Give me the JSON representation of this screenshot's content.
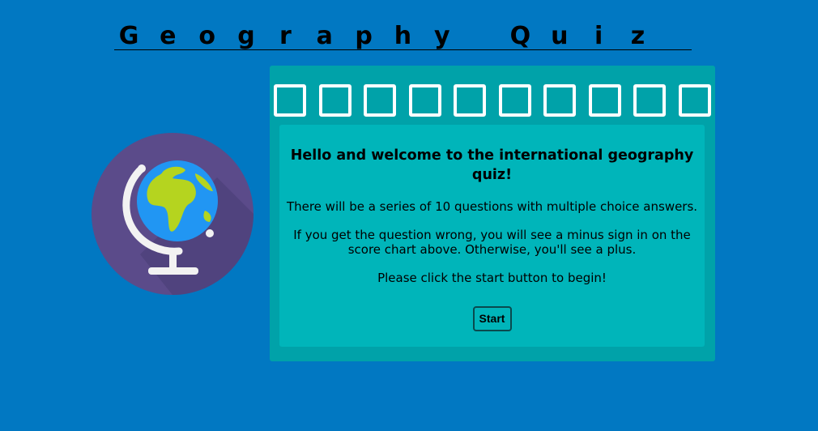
{
  "title": {
    "text": "Geography Quiz",
    "letters": [
      "G",
      "e",
      "o",
      "g",
      "r",
      "a",
      "p",
      "h",
      "y",
      "",
      "Q",
      "u",
      "i",
      "z",
      ""
    ]
  },
  "globe": {
    "icon": "globe-icon",
    "colors": {
      "circle": "#5b4b8a",
      "ocean": "#2196f3",
      "land": "#b5d41f",
      "stand": "#f2f2f2"
    }
  },
  "score_chart": {
    "count": 10,
    "box_color": "#ffffff",
    "boxes": [
      "",
      "",
      "",
      "",
      "",
      "",
      "",
      "",
      "",
      ""
    ]
  },
  "intro": {
    "heading": "Hello and welcome to the international geography quiz!",
    "paragraph1": "There will be a series of 10 questions with multiple choice answers.",
    "paragraph2": "If you get the question wrong, you will see a minus sign in on the score chart above. Otherwise, you'll see a plus.",
    "paragraph3": "Please click the start button to begin!",
    "start_label": "Start"
  },
  "colors": {
    "background": "#0178c2",
    "panel": "#00a2a9",
    "inner_panel": "#00b5ba"
  }
}
